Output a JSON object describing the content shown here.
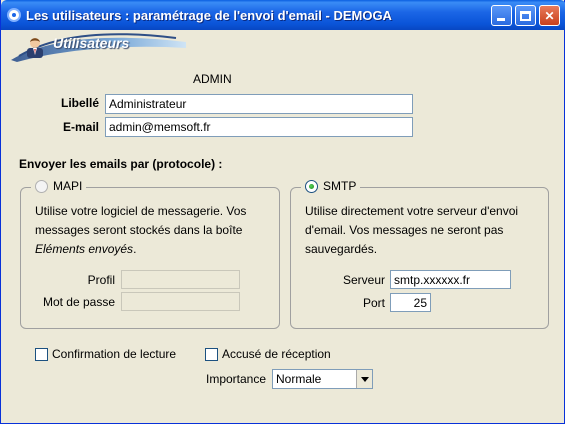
{
  "window": {
    "title": "Les utilisateurs : paramétrage de l'envoi d'email - DEMOGA",
    "controls": {
      "minimize": "minimize-icon",
      "maximize": "maximize-icon",
      "close": "✕"
    }
  },
  "banner": {
    "label": "Utilisateurs",
    "icon": "user-avatar-icon"
  },
  "user": {
    "code": "ADMIN",
    "libelle_label": "Libellé",
    "libelle_value": "Administrateur",
    "email_label": "E-mail",
    "email_value": "admin@memsoft.fr"
  },
  "protocol": {
    "section_title": "Envoyer les emails par (protocole) :",
    "mapi": {
      "label": "MAPI",
      "selected": false,
      "desc_line1": "Utilise votre logiciel de messagerie. Vos",
      "desc_line2": "messages seront stockés dans la boîte",
      "desc_line3_italic": "Eléments envoyés",
      "desc_line3_end": ".",
      "profil_label": "Profil",
      "profil_value": "",
      "password_label": "Mot de passe",
      "password_value": ""
    },
    "smtp": {
      "label": "SMTP",
      "selected": true,
      "desc_line1": "Utilise directement votre serveur d'envoi",
      "desc_line2": "d'email. Vos messages ne seront pas",
      "desc_line3": "sauvegardés.",
      "server_label": "Serveur",
      "server_value": "smtp.xxxxxx.fr",
      "port_label": "Port",
      "port_value": "25"
    }
  },
  "options": {
    "read_receipt_label": "Confirmation de lecture",
    "read_receipt_checked": false,
    "delivery_receipt_label": "Accusé de réception",
    "delivery_receipt_checked": false,
    "importance_label": "Importance",
    "importance_value": "Normale"
  }
}
